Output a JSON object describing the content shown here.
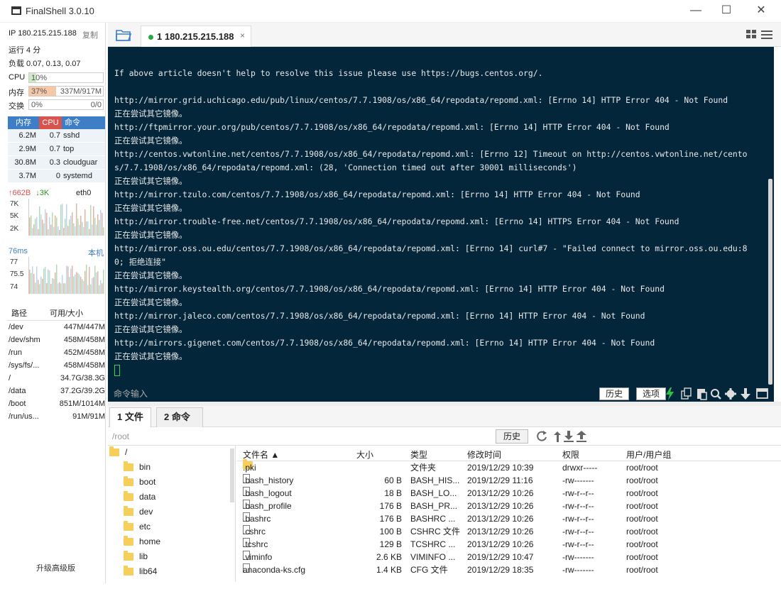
{
  "window": {
    "title": "FinalShell 3.0.10",
    "minimize": "—",
    "maximize": "☐",
    "close": "✕"
  },
  "sidebar": {
    "ip_line": "IP 180.215.215.188",
    "copy": "复制",
    "uptime": "运行 4 分",
    "load": "负载 0.07, 0.13, 0.07",
    "cpu": {
      "label": "CPU",
      "value": "10%",
      "fraction": 0.1
    },
    "memory": {
      "label": "内存",
      "value": "37%",
      "detail": "337M/917M",
      "fraction": 0.37
    },
    "swap": {
      "label": "交换",
      "value": "0%",
      "detail": "0/0",
      "fraction": 0.0
    },
    "proc_headers": [
      "内存",
      "CPU",
      "命令"
    ],
    "processes": [
      {
        "mem": "6.2M",
        "cpu": "0.7",
        "cmd": "sshd"
      },
      {
        "mem": "2.9M",
        "cpu": "0.7",
        "cmd": "top"
      },
      {
        "mem": "30.8M",
        "cpu": "0.3",
        "cmd": "cloudguar"
      },
      {
        "mem": "3.7M",
        "cpu": "0",
        "cmd": "systemd"
      }
    ],
    "net": {
      "up": "↑662B",
      "down": "↓3K",
      "iface": "eth0",
      "ticks": [
        "7K",
        "5K",
        "2K"
      ]
    },
    "ping": {
      "latency": "76ms",
      "host": "本机",
      "ticks": [
        "77",
        "75.5",
        "74"
      ]
    },
    "disk_headers": [
      "路径",
      "可用/大小"
    ],
    "disks": [
      {
        "path": "/dev",
        "size": "447M/447M"
      },
      {
        "path": "/dev/shm",
        "size": "458M/458M"
      },
      {
        "path": "/run",
        "size": "452M/458M"
      },
      {
        "path": "/sys/fs/...",
        "size": "458M/458M"
      },
      {
        "path": "/",
        "size": "34.7G/38.3G"
      },
      {
        "path": "/data",
        "size": "37.2G/39.2G"
      },
      {
        "path": "/boot",
        "size": "851M/1014M"
      },
      {
        "path": "/run/us...",
        "size": "91M/91M"
      }
    ],
    "upgrade": "升级高级版"
  },
  "tabs": {
    "session_label": "1 180.215.215.188",
    "close": "×"
  },
  "terminal": {
    "lines": [
      "If above article doesn't help to resolve this issue please use https://bugs.centos.org/.",
      "",
      "http://mirror.grid.uchicago.edu/pub/linux/centos/7.7.1908/os/x86_64/repodata/repomd.xml: [Errno 14] HTTP Error 404 - Not Found",
      "正在尝试其它镜像。",
      "http://ftpmirror.your.org/pub/centos/7.7.1908/os/x86_64/repodata/repomd.xml: [Errno 14] HTTP Error 404 - Not Found",
      "正在尝试其它镜像。",
      "http://centos.vwtonline.net/centos/7.7.1908/os/x86_64/repodata/repomd.xml: [Errno 12] Timeout on http://centos.vwtonline.net/cento",
      "s/7.7.1908/os/x86_64/repodata/repomd.xml: (28, 'Connection timed out after 30001 milliseconds')",
      "正在尝试其它镜像。",
      "http://mirror.tzulo.com/centos/7.7.1908/os/x86_64/repodata/repomd.xml: [Errno 14] HTTP Error 404 - Not Found",
      "正在尝试其它镜像。",
      "http://mirror.trouble-free.net/centos/7.7.1908/os/x86_64/repodata/repomd.xml: [Errno 14] HTTPS Error 404 - Not Found",
      "正在尝试其它镜像。",
      "http://mirror.oss.ou.edu/centos/7.7.1908/os/x86_64/repodata/repomd.xml: [Errno 14] curl#7 - \"Failed connect to mirror.oss.ou.edu:8",
      "0; 拒绝连接\"",
      "正在尝试其它镜像。",
      "http://mirror.keystealth.org/centos/7.7.1908/os/x86_64/repodata/repomd.xml: [Errno 14] HTTP Error 404 - Not Found",
      "正在尝试其它镜像。",
      "http://mirror.jaleco.com/centos/7.7.1908/os/x86_64/repodata/repomd.xml: [Errno 14] HTTP Error 404 - Not Found",
      "正在尝试其它镜像。",
      "http://mirrors.gigenet.com/centos/7.7.1908/os/x86_64/repodata/repomd.xml: [Errno 14] HTTP Error 404 - Not Found",
      "正在尝试其它镜像。"
    ],
    "cmd_placeholder": "命令输入",
    "history_btn": "历史",
    "options_btn": "选项"
  },
  "files": {
    "tab_files": "1 文件",
    "tab_commands": "2 命令",
    "path": "/root",
    "history_btn": "历史",
    "tree_root": "/",
    "tree": [
      "bin",
      "boot",
      "data",
      "dev",
      "etc",
      "home",
      "lib",
      "lib64"
    ],
    "headers": [
      "文件名 ▲",
      "大小",
      "类型",
      "修改时间",
      "权限",
      "用户/用户组"
    ],
    "rows": [
      {
        "name": ".pki",
        "size": "",
        "type": "文件夹",
        "mtime": "2019/12/29 10:39",
        "perm": "drwxr-----",
        "owner": "root/root",
        "folder": true
      },
      {
        "name": ".bash_history",
        "size": "60 B",
        "type": "BASH_HIS...",
        "mtime": "2019/12/29 11:16",
        "perm": "-rw-------",
        "owner": "root/root",
        "folder": false
      },
      {
        "name": ".bash_logout",
        "size": "18 B",
        "type": "BASH_LO...",
        "mtime": "2013/12/29 10:26",
        "perm": "-rw-r--r--",
        "owner": "root/root",
        "folder": false
      },
      {
        "name": ".bash_profile",
        "size": "176 B",
        "type": "BASH_PR...",
        "mtime": "2013/12/29 10:26",
        "perm": "-rw-r--r--",
        "owner": "root/root",
        "folder": false
      },
      {
        "name": ".bashrc",
        "size": "176 B",
        "type": "BASHRC ...",
        "mtime": "2013/12/29 10:26",
        "perm": "-rw-r--r--",
        "owner": "root/root",
        "folder": false
      },
      {
        "name": ".cshrc",
        "size": "100 B",
        "type": "CSHRC 文件",
        "mtime": "2013/12/29 10:26",
        "perm": "-rw-r--r--",
        "owner": "root/root",
        "folder": false
      },
      {
        "name": ".tcshrc",
        "size": "129 B",
        "type": "TCSHRC ...",
        "mtime": "2013/12/29 10:26",
        "perm": "-rw-r--r--",
        "owner": "root/root",
        "folder": false
      },
      {
        "name": ".viminfo",
        "size": "2.6 KB",
        "type": "VIMINFO ...",
        "mtime": "2019/12/29 10:47",
        "perm": "-rw-------",
        "owner": "root/root",
        "folder": false
      },
      {
        "name": "anaconda-ks.cfg",
        "size": "1.4 KB",
        "type": "CFG 文件",
        "mtime": "2019/12/29 18:35",
        "perm": "-rw-------",
        "owner": "root/root",
        "folder": false
      }
    ]
  },
  "colors": {
    "terminal_bg": "#04263b",
    "terminal_fg": "#e8e8e8",
    "proc_header_mem": "#3d7ec7",
    "proc_header_cpu": "#d9534f",
    "proc_header_cmd": "#3d7ec7",
    "cpu_fill": "#cfe9c8",
    "mem_fill": "#f6c8a8",
    "chart_fill": "#bcd6ee",
    "active_dot": "#22aa44"
  },
  "icons": {
    "app": "app-icon",
    "folder_open": "folder-open-icon",
    "layout": "grid-layout-icon",
    "lightning": "lightning-icon",
    "copy": "copy-icon",
    "paste": "paste-icon",
    "search": "search-icon",
    "settings": "gear-icon",
    "download": "download-icon",
    "window": "window-icon",
    "refresh": "refresh-icon",
    "up": "up-dir-icon",
    "download_file": "download-file-icon",
    "upload": "upload-icon"
  }
}
